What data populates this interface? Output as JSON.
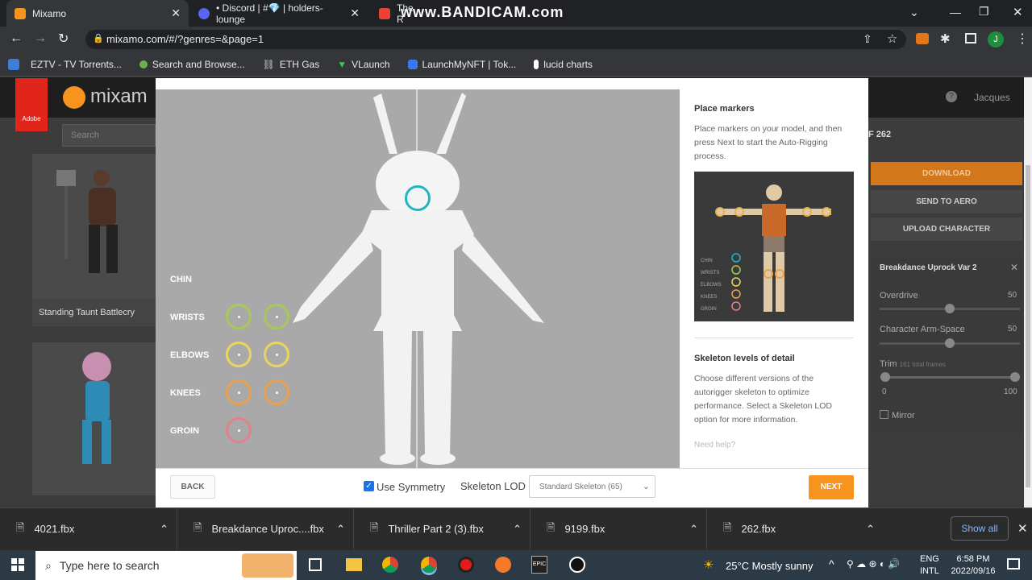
{
  "browser": {
    "tabs": [
      {
        "label": "Mixamo",
        "icon": "mixamo-icon",
        "color": "#f7941d"
      },
      {
        "label": "• Discord | #💎 | holders-lounge",
        "icon": "discord-icon",
        "color": "#5865f2"
      },
      {
        "label": "The R",
        "icon": "gmail-icon",
        "color": "#ea4335"
      }
    ],
    "watermark": "www.BANDICAM.com",
    "url": "mixamo.com/#/?genres=&page=1",
    "profile": "J",
    "bookmarks": [
      "EZTV - TV Torrents...",
      "Search and Browse...",
      "ETH Gas",
      "VLaunch",
      "LaunchMyNFT | Tok...",
      "lucid charts"
    ]
  },
  "mixamo": {
    "logo_text": "mixam",
    "adobe": "Adobe",
    "search_placeholder": "Search",
    "user": "Jacques",
    "count": "F 262",
    "card1": "Standing Taunt Battlecry",
    "download": "DOWNLOAD",
    "send_aero": "SEND TO AERO",
    "upload": "UPLOAD CHARACTER",
    "anim_name": "Breakdance Uprock Var 2",
    "overdrive": "Overdrive",
    "overdrive_val": "50",
    "armspace": "Character Arm-Space",
    "armspace_val": "50",
    "trim": "Trim",
    "trim_note": "161 total frames",
    "trim_min": "0",
    "trim_max": "100",
    "mirror": "Mirror"
  },
  "dialog": {
    "markers": [
      "CHIN",
      "WRISTS",
      "ELBOWS",
      "KNEES",
      "GROIN"
    ],
    "place_title": "Place markers",
    "place_text": "Place markers on your model, and then press Next to start the Auto-Rigging process.",
    "legend": [
      "CHIN",
      "WRISTS",
      "ELBOWS",
      "KNEES",
      "GROIN"
    ],
    "lod_title": "Skeleton levels of detail",
    "lod_text": "Choose different versions of the autorigger skeleton to optimize performance. Select a Skeleton LOD option for more information.",
    "help": "Need help?",
    "back": "BACK",
    "symmetry": "Use Symmetry",
    "lod_label": "Skeleton LOD",
    "lod_value": "Standard Skeleton (65)",
    "next": "NEXT"
  },
  "downloads": {
    "items": [
      "4021.fbx",
      "Breakdance Uproc....fbx",
      "Thriller Part 2 (3).fbx",
      "9199.fbx",
      "262.fbx"
    ],
    "show_all": "Show all"
  },
  "taskbar": {
    "search": "Type here to search",
    "weather": "25°C  Mostly sunny",
    "lang1": "ENG",
    "lang2": "INTL",
    "time": "6:58 PM",
    "date": "2022/09/16"
  }
}
